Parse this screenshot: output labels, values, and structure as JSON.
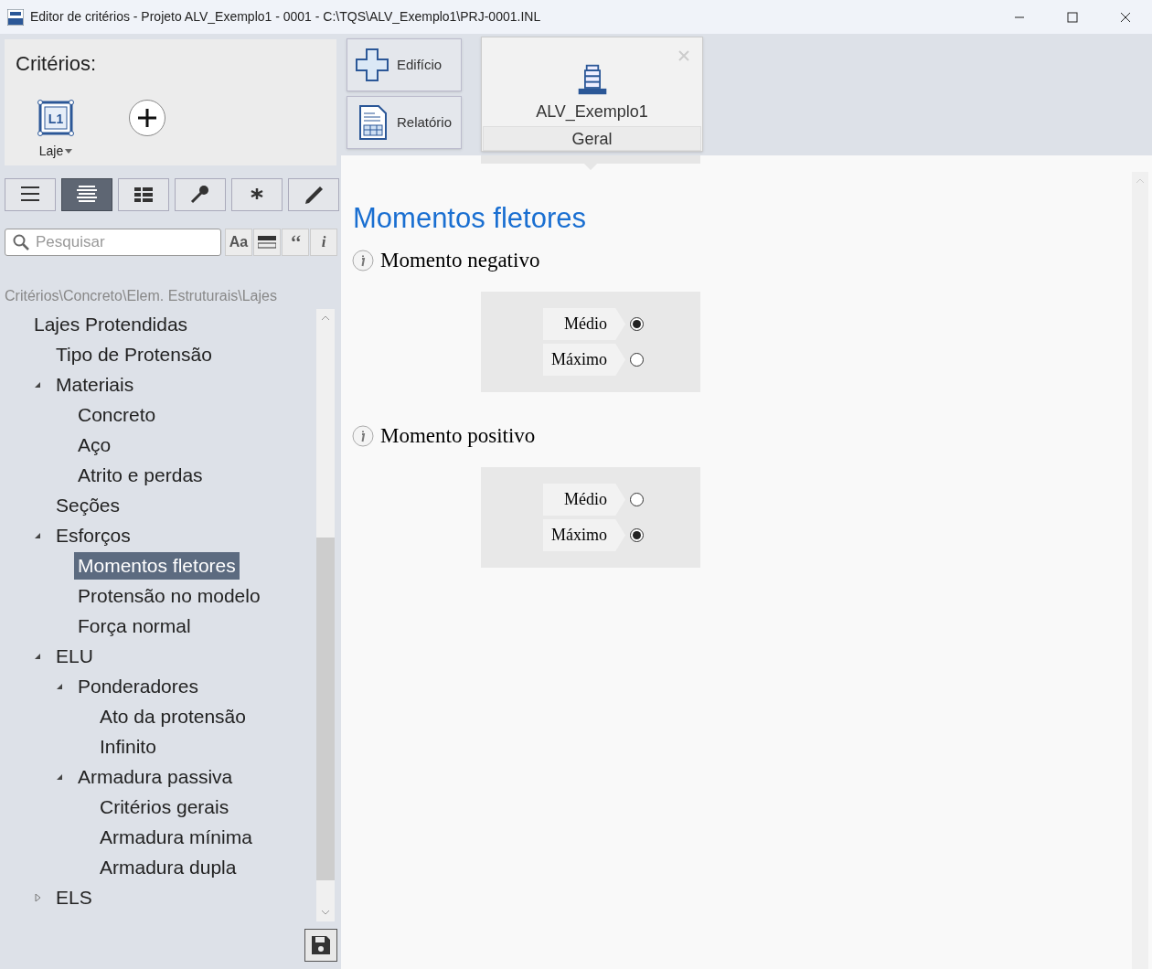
{
  "window": {
    "title": "Editor de critérios - Projeto ALV_Exemplo1 - 0001 - C:\\TQS\\ALV_Exemplo1\\PRJ-0001.INL"
  },
  "criteria_panel": {
    "title": "Critérios:",
    "items": [
      {
        "kind": "element",
        "icon_text": "L1",
        "label": "Laje"
      },
      {
        "kind": "add"
      }
    ]
  },
  "view_buttons": [
    {
      "kind": "list",
      "selected": false
    },
    {
      "kind": "lines",
      "selected": true
    },
    {
      "kind": "grid",
      "selected": false
    },
    {
      "kind": "key",
      "selected": false
    },
    {
      "kind": "star",
      "selected": false
    },
    {
      "kind": "pencil",
      "selected": false
    }
  ],
  "search": {
    "placeholder": "Pesquisar",
    "options": [
      {
        "kind": "text",
        "label": "Aa"
      },
      {
        "kind": "bar"
      },
      {
        "kind": "quote",
        "label": "‘‘"
      },
      {
        "kind": "info",
        "label": "i"
      }
    ]
  },
  "breadcrumb": "Critérios\\Concreto\\Elem. Estruturais\\Lajes",
  "tree": [
    {
      "label": "Lajes Protendidas",
      "children": [
        {
          "label": "Tipo de Protensão",
          "selected": false
        },
        {
          "label": "Materiais",
          "selected": false,
          "expanded": true,
          "children": [
            {
              "label": "Concreto",
              "selected": false
            },
            {
              "label": "Aço",
              "selected": false
            },
            {
              "label": "Atrito e perdas",
              "selected": false
            }
          ]
        },
        {
          "label": "Seções",
          "selected": false
        },
        {
          "label": "Esforços",
          "selected": false,
          "expanded": true,
          "children": [
            {
              "label": "Momentos fletores",
              "selected": true
            },
            {
              "label": "Protensão no modelo",
              "selected": false
            },
            {
              "label": "Força normal",
              "selected": false
            }
          ]
        },
        {
          "label": "ELU",
          "selected": false,
          "expanded": true,
          "children": [
            {
              "label": "Ponderadores",
              "selected": false,
              "expanded": true,
              "children": [
                {
                  "label": "Ato da protensão",
                  "selected": false
                },
                {
                  "label": "Infinito",
                  "selected": false
                }
              ]
            },
            {
              "label": "Armadura passiva",
              "selected": false,
              "expanded": true,
              "children": [
                {
                  "label": "Critérios gerais",
                  "selected": false
                },
                {
                  "label": "Armadura mínima",
                  "selected": false
                },
                {
                  "label": "Armadura dupla",
                  "selected": false
                }
              ]
            }
          ]
        },
        {
          "label": "ELS",
          "selected": false,
          "expanded": false
        }
      ]
    }
  ],
  "nav_buttons": [
    {
      "kind": "building",
      "label": "Edifício"
    },
    {
      "kind": "report",
      "label": "Relatório"
    }
  ],
  "project_tab": {
    "name": "ALV_Exemplo1",
    "subtitle": "Geral"
  },
  "content": {
    "heading": "Momentos fletores",
    "sections": [
      {
        "title": "Momento negativo",
        "options": [
          {
            "label": "Médio",
            "selected": true
          },
          {
            "label": "Máximo",
            "selected": false
          }
        ]
      },
      {
        "title": "Momento positivo",
        "options": [
          {
            "label": "Médio",
            "selected": false
          },
          {
            "label": "Máximo",
            "selected": true
          }
        ]
      }
    ]
  }
}
